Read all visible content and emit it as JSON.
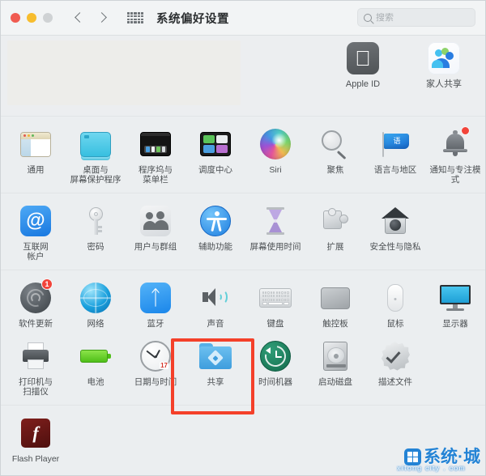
{
  "window": {
    "title": "系统偏好设置",
    "traffic_lights": [
      "close",
      "minimize",
      "zoom"
    ],
    "nav": {
      "back": "back-arrow",
      "forward": "forward-arrow",
      "grid": "show-all-grid"
    },
    "search": {
      "placeholder": "搜索",
      "value": "",
      "icon": "search-icon"
    }
  },
  "accent_colors": {
    "highlight_box": "#f4402a",
    "badge_red": "#f2443a",
    "watermark_blue": "#1b7fd4"
  },
  "hero": {
    "placeholder_present": true,
    "apps": [
      {
        "label": "Apple ID",
        "icon": "apple-id-icon"
      },
      {
        "label": "家人共享",
        "icon": "family-sharing-icon"
      }
    ]
  },
  "sections": [
    {
      "name": "personal",
      "items": [
        {
          "label": "通用",
          "icon": "general-icon"
        },
        {
          "label": "桌面与\n屏幕保护程序",
          "line1": "桌面与",
          "line2": "屏幕保护程序",
          "icon": "desktop-screensaver-icon"
        },
        {
          "label": "程序坞与\n菜单栏",
          "line1": "程序坞与",
          "line2": "菜单栏",
          "icon": "dock-menubar-icon"
        },
        {
          "label": "调度中心",
          "icon": "mission-control-icon"
        },
        {
          "label": "Siri",
          "icon": "siri-icon"
        },
        {
          "label": "聚焦",
          "icon": "spotlight-icon"
        },
        {
          "label": "语言与地区",
          "icon": "language-region-icon"
        },
        {
          "label": "通知与专注模式",
          "icon": "notifications-focus-icon",
          "badge": "dot"
        }
      ]
    },
    {
      "name": "accounts",
      "items": [
        {
          "label": "互联网\n帐户",
          "line1": "互联网",
          "line2": "帐户",
          "icon": "internet-accounts-icon"
        },
        {
          "label": "密码",
          "icon": "passwords-key-icon"
        },
        {
          "label": "用户与群组",
          "icon": "users-groups-icon"
        },
        {
          "label": "辅助功能",
          "icon": "accessibility-icon"
        },
        {
          "label": "屏幕使用时间",
          "icon": "screen-time-icon"
        },
        {
          "label": "扩展",
          "icon": "extensions-puzzle-icon"
        },
        {
          "label": "安全性与隐私",
          "icon": "security-privacy-icon"
        }
      ]
    },
    {
      "name": "hardware",
      "items": [
        {
          "label": "软件更新",
          "icon": "software-update-icon",
          "badge": "1"
        },
        {
          "label": "网络",
          "icon": "network-globe-icon"
        },
        {
          "label": "蓝牙",
          "icon": "bluetooth-icon"
        },
        {
          "label": "声音",
          "icon": "sound-speaker-icon"
        },
        {
          "label": "键盘",
          "icon": "keyboard-icon"
        },
        {
          "label": "触控板",
          "icon": "trackpad-icon"
        },
        {
          "label": "鼠标",
          "icon": "mouse-icon"
        },
        {
          "label": "显示器",
          "icon": "display-icon"
        },
        {
          "label": "打印机与\n扫描仪",
          "line1": "打印机与",
          "line2": "扫描仪",
          "icon": "printers-scanners-icon"
        },
        {
          "label": "电池",
          "icon": "battery-icon"
        },
        {
          "label": "日期与时间",
          "icon": "date-time-icon",
          "clock_day": "17"
        },
        {
          "label": "共享",
          "icon": "sharing-folder-icon",
          "highlighted": true
        },
        {
          "label": "时间机器",
          "icon": "time-machine-icon"
        },
        {
          "label": "启动磁盘",
          "icon": "startup-disk-icon"
        },
        {
          "label": "描述文件",
          "icon": "profiles-icon"
        }
      ]
    },
    {
      "name": "other",
      "items": [
        {
          "label": "Flash Player",
          "icon": "flash-player-icon"
        }
      ]
    }
  ],
  "watermark": {
    "title": "系统·城",
    "subtitle": "xitong city . com",
    "logo": "windows-logo-icon"
  }
}
